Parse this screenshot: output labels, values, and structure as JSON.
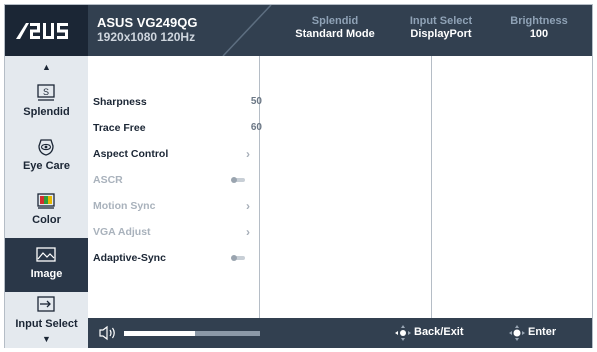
{
  "brand": {
    "logo_text": "/ISUS"
  },
  "header": {
    "model": "ASUS VG249QG",
    "resolution": "1920x1080 120Hz",
    "stats": [
      {
        "key": "Splendid",
        "value": "Standard Mode"
      },
      {
        "key": "Input Select",
        "value": "DisplayPort"
      },
      {
        "key": "Brightness",
        "value": "100"
      }
    ]
  },
  "sidebar": {
    "up_arrow": "▲",
    "down_arrow": "▼",
    "items": [
      {
        "label": "Splendid",
        "icon": "splendid-icon",
        "active": false
      },
      {
        "label": "Eye Care",
        "icon": "eye-icon",
        "active": false
      },
      {
        "label": "Color",
        "icon": "color-bars-icon",
        "active": false
      },
      {
        "label": "Image",
        "icon": "image-icon",
        "active": true
      },
      {
        "label": "Input Select",
        "icon": "input-select-icon",
        "active": false
      }
    ]
  },
  "menu": {
    "items": [
      {
        "label": "Sharpness",
        "value": "50",
        "type": "value",
        "enabled": true
      },
      {
        "label": "Trace Free",
        "value": "60",
        "type": "value",
        "enabled": true
      },
      {
        "label": "Aspect Control",
        "type": "submenu",
        "enabled": true
      },
      {
        "label": "ASCR",
        "type": "toggle",
        "enabled": false
      },
      {
        "label": "Motion Sync",
        "type": "submenu",
        "enabled": false
      },
      {
        "label": "VGA Adjust",
        "type": "submenu",
        "enabled": false
      },
      {
        "label": "Adaptive-Sync",
        "type": "toggle",
        "enabled": true
      }
    ]
  },
  "footer": {
    "volume_level": 0.52,
    "back_label": "Back/Exit",
    "enter_label": "Enter"
  },
  "colors": {
    "header_bg": "#324050",
    "logo_bg": "#1b2635",
    "sidebar_bg": "#e4e9ee",
    "active_item_bg": "#2a3748",
    "disabled_text": "#a9b2bc"
  }
}
